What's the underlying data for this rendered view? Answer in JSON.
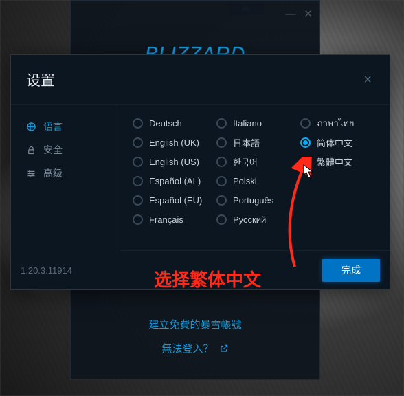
{
  "login": {
    "create_account": "建立免費的暴雪帳號",
    "cannot_login": "無法登入？"
  },
  "small_tab": {
    "label": ""
  },
  "modal": {
    "title": "设置",
    "close": "×",
    "version": "1.20.3.11914",
    "done": "完成"
  },
  "sidebar": {
    "items": [
      {
        "label": "语言",
        "icon": "globe"
      },
      {
        "label": "安全",
        "icon": "lock"
      },
      {
        "label": "高级",
        "icon": "sliders"
      }
    ]
  },
  "languages": {
    "col1": [
      {
        "label": "Deutsch",
        "selected": false
      },
      {
        "label": "English (UK)",
        "selected": false
      },
      {
        "label": "English (US)",
        "selected": false
      },
      {
        "label": "Español (AL)",
        "selected": false
      },
      {
        "label": "Español (EU)",
        "selected": false
      },
      {
        "label": "Français",
        "selected": false
      }
    ],
    "col2": [
      {
        "label": "Italiano",
        "selected": false
      },
      {
        "label": "日本語",
        "selected": false
      },
      {
        "label": "한국어",
        "selected": false
      },
      {
        "label": "Polski",
        "selected": false
      },
      {
        "label": "Português",
        "selected": false
      },
      {
        "label": "Русский",
        "selected": false
      }
    ],
    "col3": [
      {
        "label": "ภาษาไทย",
        "selected": false
      },
      {
        "label": "简体中文",
        "selected": true
      },
      {
        "label": "繁體中文",
        "selected": false
      }
    ]
  },
  "annotation": "选择繁体中文",
  "colors": {
    "accent": "#00aeff",
    "link": "#1c9ad6",
    "red": "#ff2a1a"
  }
}
